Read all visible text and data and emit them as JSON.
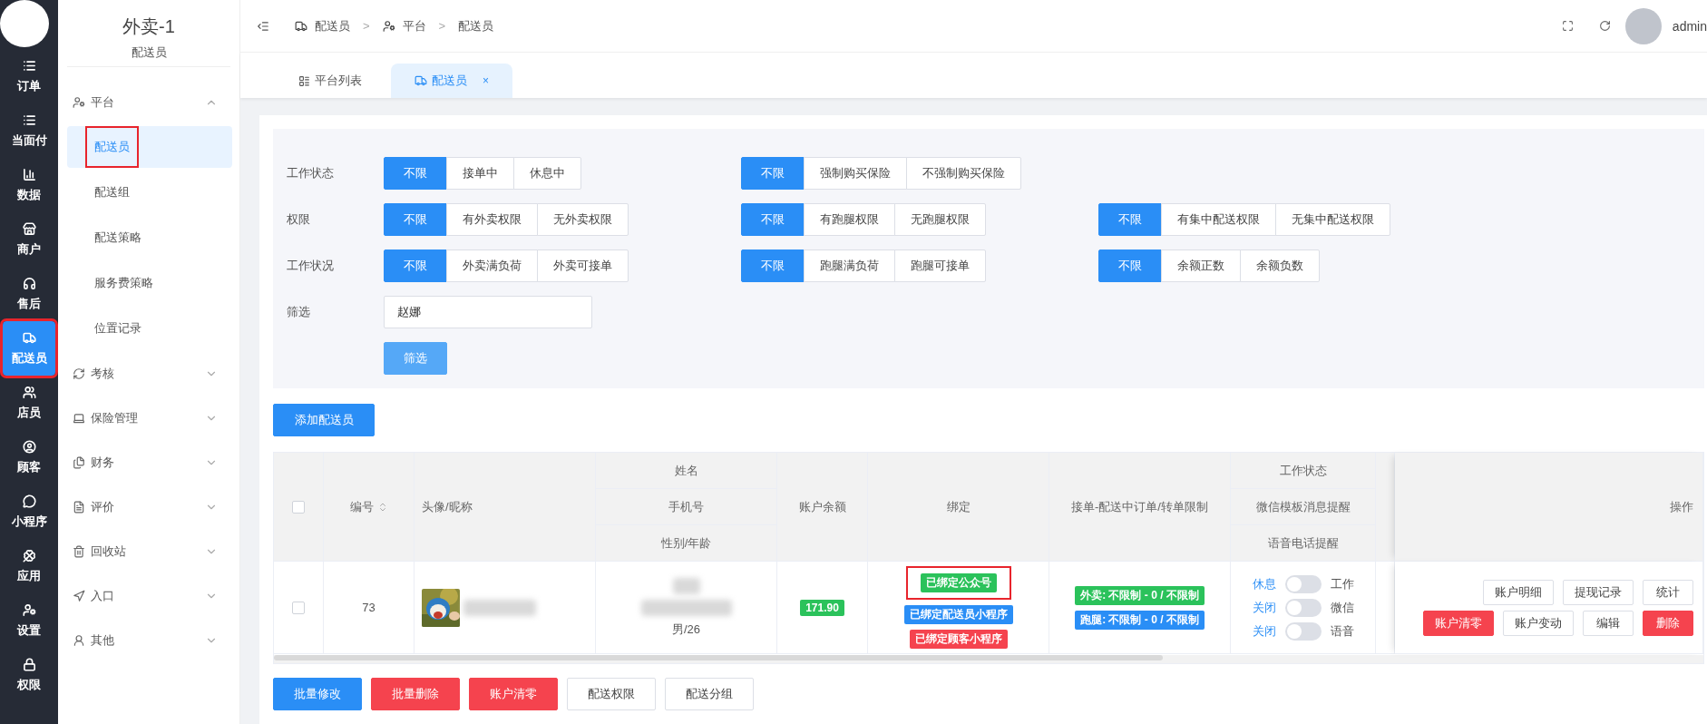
{
  "rail": {
    "items": [
      {
        "label": "订单",
        "selected": false,
        "highlighted": false
      },
      {
        "label": "当面付",
        "selected": false,
        "highlighted": false
      },
      {
        "label": "数据",
        "selected": false,
        "highlighted": false
      },
      {
        "label": "商户",
        "selected": false,
        "highlighted": false
      },
      {
        "label": "售后",
        "selected": false,
        "highlighted": false
      },
      {
        "label": "配送员",
        "selected": true,
        "highlighted": true
      },
      {
        "label": "店员",
        "selected": false,
        "highlighted": false
      },
      {
        "label": "顾客",
        "selected": false,
        "highlighted": false
      },
      {
        "label": "小程序",
        "selected": false,
        "highlighted": false
      },
      {
        "label": "应用",
        "selected": false,
        "highlighted": false
      },
      {
        "label": "设置",
        "selected": false,
        "highlighted": false
      },
      {
        "label": "权限",
        "selected": false,
        "highlighted": false
      }
    ]
  },
  "sidebar": {
    "title": "外卖-1",
    "subtitle": "配送员",
    "items": [
      {
        "label": "平台",
        "expanded": true,
        "children": [
          {
            "label": "配送员",
            "selected": true,
            "highlighted": true
          },
          {
            "label": "配送组",
            "selected": false,
            "highlighted": false
          },
          {
            "label": "配送策略",
            "selected": false,
            "highlighted": false
          },
          {
            "label": "服务费策略",
            "selected": false,
            "highlighted": false
          },
          {
            "label": "位置记录",
            "selected": false,
            "highlighted": false
          }
        ]
      },
      {
        "label": "考核",
        "expanded": false
      },
      {
        "label": "保险管理",
        "expanded": false
      },
      {
        "label": "财务",
        "expanded": false
      },
      {
        "label": "评价",
        "expanded": false
      },
      {
        "label": "回收站",
        "expanded": false
      },
      {
        "label": "入口",
        "expanded": false
      },
      {
        "label": "其他",
        "expanded": false
      }
    ]
  },
  "breadcrumb": [
    "配送员",
    "平台",
    "配送员"
  ],
  "breadcrumb_separator": ">",
  "user": {
    "name": "admin"
  },
  "tabs": [
    {
      "label": "平台列表",
      "selected": false,
      "closable": false
    },
    {
      "label": "配送员",
      "selected": true,
      "closable": true
    }
  ],
  "tab_close": "×",
  "filters": [
    {
      "label": "工作状态",
      "groups": [
        [
          {
            "label": "不限",
            "selected": true
          },
          {
            "label": "接单中",
            "selected": false
          },
          {
            "label": "休息中",
            "selected": false
          }
        ],
        [
          {
            "label": "不限",
            "selected": true
          },
          {
            "label": "强制购买保险",
            "selected": false
          },
          {
            "label": "不强制购买保险",
            "selected": false
          }
        ]
      ]
    },
    {
      "label": "权限",
      "groups": [
        [
          {
            "label": "不限",
            "selected": true
          },
          {
            "label": "有外卖权限",
            "selected": false
          },
          {
            "label": "无外卖权限",
            "selected": false
          }
        ],
        [
          {
            "label": "不限",
            "selected": true
          },
          {
            "label": "有跑腿权限",
            "selected": false
          },
          {
            "label": "无跑腿权限",
            "selected": false
          }
        ],
        [
          {
            "label": "不限",
            "selected": true
          },
          {
            "label": "有集中配送权限",
            "selected": false
          },
          {
            "label": "无集中配送权限",
            "selected": false
          }
        ]
      ]
    },
    {
      "label": "工作状况",
      "groups": [
        [
          {
            "label": "不限",
            "selected": true
          },
          {
            "label": "外卖满负荷",
            "selected": false
          },
          {
            "label": "外卖可接单",
            "selected": false
          }
        ],
        [
          {
            "label": "不限",
            "selected": true
          },
          {
            "label": "跑腿满负荷",
            "selected": false
          },
          {
            "label": "跑腿可接单",
            "selected": false
          }
        ],
        [
          {
            "label": "不限",
            "selected": true
          },
          {
            "label": "余额正数",
            "selected": false
          },
          {
            "label": "余额负数",
            "selected": false
          }
        ]
      ]
    }
  ],
  "search": {
    "label": "筛选",
    "value": "赵娜",
    "button": "筛选"
  },
  "add_button": "添加配送员",
  "table": {
    "select_all": {
      "checked": false
    },
    "columns": {
      "id": "编号",
      "avatar": "头像/昵称",
      "name": "姓名",
      "phone": "手机号",
      "gender_age": "性别/年龄",
      "balance": "账户余额",
      "binding": "绑定",
      "limits": "接单-配送中订单/转单限制",
      "work_status": "工作状态",
      "wechat_notice": "微信模板消息提醒",
      "voice_notice": "语音电话提醒",
      "actions": "操作"
    },
    "rows": [
      {
        "checked": false,
        "id": "73",
        "nickname_redacted": true,
        "name_redacted": true,
        "phone_redacted": true,
        "gender_age": "男/26",
        "balance": "171.90",
        "bindings": [
          {
            "label": "已绑定公众号",
            "color": "#2bc25b",
            "highlighted": true
          },
          {
            "label": "已绑定配送员小程序",
            "color": "#2a8ef6",
            "highlighted": false
          },
          {
            "label": "已绑定顾客小程序",
            "color": "#f5434e",
            "highlighted": false
          }
        ],
        "limits": [
          {
            "label": "外卖: 不限制 - 0 / 不限制",
            "color": "#2bc25b"
          },
          {
            "label": "跑腿: 不限制 - 0 / 不限制",
            "color": "#2a8ef6"
          }
        ],
        "switches": [
          {
            "off_label": "休息",
            "on_label": "工作",
            "on": false
          },
          {
            "off_label": "关闭",
            "on_label": "微信",
            "on": false
          },
          {
            "off_label": "关闭",
            "on_label": "语音",
            "on": false
          }
        ],
        "actions": [
          [
            {
              "label": "账户明细",
              "kind": "default"
            },
            {
              "label": "提现记录",
              "kind": "default"
            },
            {
              "label": "统计",
              "kind": "default"
            }
          ],
          [
            {
              "label": "账户清零",
              "kind": "danger"
            },
            {
              "label": "账户变动",
              "kind": "default"
            },
            {
              "label": "编辑",
              "kind": "default"
            },
            {
              "label": "删除",
              "kind": "danger"
            }
          ]
        ]
      }
    ]
  },
  "bulk_buttons": [
    {
      "label": "批量修改",
      "kind": "primary"
    },
    {
      "label": "批量删除",
      "kind": "danger"
    },
    {
      "label": "账户清零",
      "kind": "danger"
    },
    {
      "label": "配送权限",
      "kind": "default"
    },
    {
      "label": "配送分组",
      "kind": "default"
    }
  ]
}
